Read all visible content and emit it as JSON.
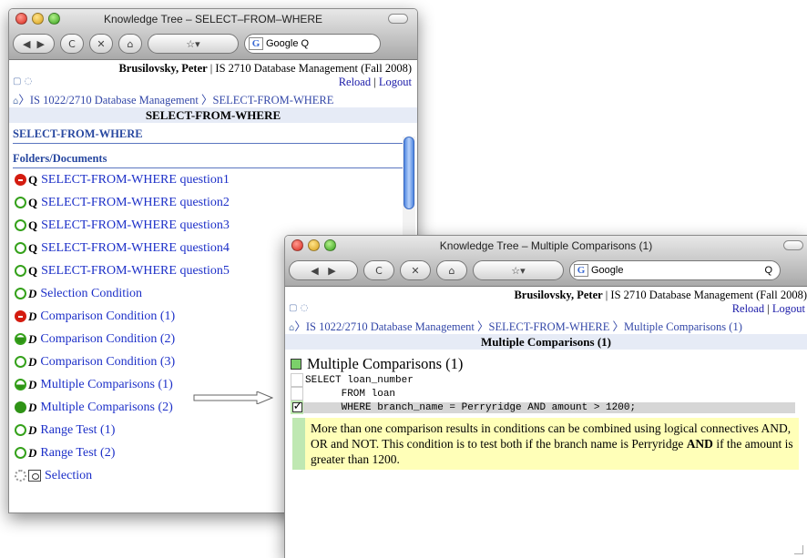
{
  "window1": {
    "title": "Knowledge Tree – SELECT–FROM–WHERE",
    "search_label": "Google",
    "search_glyph": "Q",
    "user_name": "Brusilovsky, Peter",
    "course": " | IS 2710 Database Management (Fall 2008)",
    "reload": "Reload",
    "sep": "|",
    "logout": "Logout",
    "breadcrumb": "〉IS 1022/2710 Database Management 〉SELECT-FROM-WHERE",
    "page_title": "SELECT-FROM-WHERE",
    "section1": "SELECT-FROM-WHERE",
    "section2": "Folders/Documents",
    "items": [
      {
        "label": "SELECT-FROM-WHERE question1",
        "status": "red",
        "kind": "Q"
      },
      {
        "label": "SELECT-FROM-WHERE question2",
        "status": "empty",
        "kind": "Q"
      },
      {
        "label": "SELECT-FROM-WHERE question3",
        "status": "empty",
        "kind": "Q"
      },
      {
        "label": "SELECT-FROM-WHERE question4",
        "status": "empty",
        "kind": "Q"
      },
      {
        "label": "SELECT-FROM-WHERE question5",
        "status": "empty",
        "kind": "Q"
      },
      {
        "label": "Selection Condition",
        "status": "empty",
        "kind": "D"
      },
      {
        "label": "Comparison Condition (1)",
        "status": "red",
        "kind": "D"
      },
      {
        "label": "Comparison Condition (2)",
        "status": "most",
        "kind": "D"
      },
      {
        "label": "Comparison Condition (3)",
        "status": "empty",
        "kind": "D"
      },
      {
        "label": "Multiple Comparisons (1)",
        "status": "half",
        "kind": "D"
      },
      {
        "label": "Multiple Comparisons (2)",
        "status": "full",
        "kind": "D"
      },
      {
        "label": "Range Test (1)",
        "status": "empty",
        "kind": "D"
      },
      {
        "label": "Range Test (2)",
        "status": "empty",
        "kind": "D"
      },
      {
        "label": "Selection",
        "status": "dots",
        "kind": "img"
      }
    ]
  },
  "window2": {
    "title": "Knowledge Tree – Multiple Comparisons (1)",
    "search_label": "Google",
    "search_glyph": "Q",
    "user_name": "Brusilovsky, Peter",
    "course": " | IS 2710 Database Management (Fall 2008)",
    "reload": "Reload",
    "sep": "|",
    "logout": "Logout",
    "breadcrumb": "〉IS 1022/2710 Database Management 〉SELECT-FROM-WHERE 〉Multiple Comparisons (1)",
    "page_title": "Multiple Comparisons (1)",
    "heading": "Multiple Comparisons (1)",
    "code": [
      "SELECT loan_number",
      "      FROM loan",
      "      WHERE branch_name = Perryridge AND amount > 1200;"
    ],
    "explanation_1": "More than one comparison results in conditions can be combined using logical connectives AND, OR and NOT. This condition is to test both if the branch name is Perryridge ",
    "explanation_bold": "AND",
    "explanation_2": " if the amount is greater than 1200."
  },
  "toolbar": {
    "back": "◀",
    "forward": "▶",
    "reload": "C",
    "stop": "✕",
    "home": "⌂",
    "star": "☆▾",
    "g": "G"
  },
  "colors": {
    "link": "#1c2fc8",
    "green": "#2f9316",
    "red": "#d41c10",
    "highlight": "#ffffb8"
  }
}
